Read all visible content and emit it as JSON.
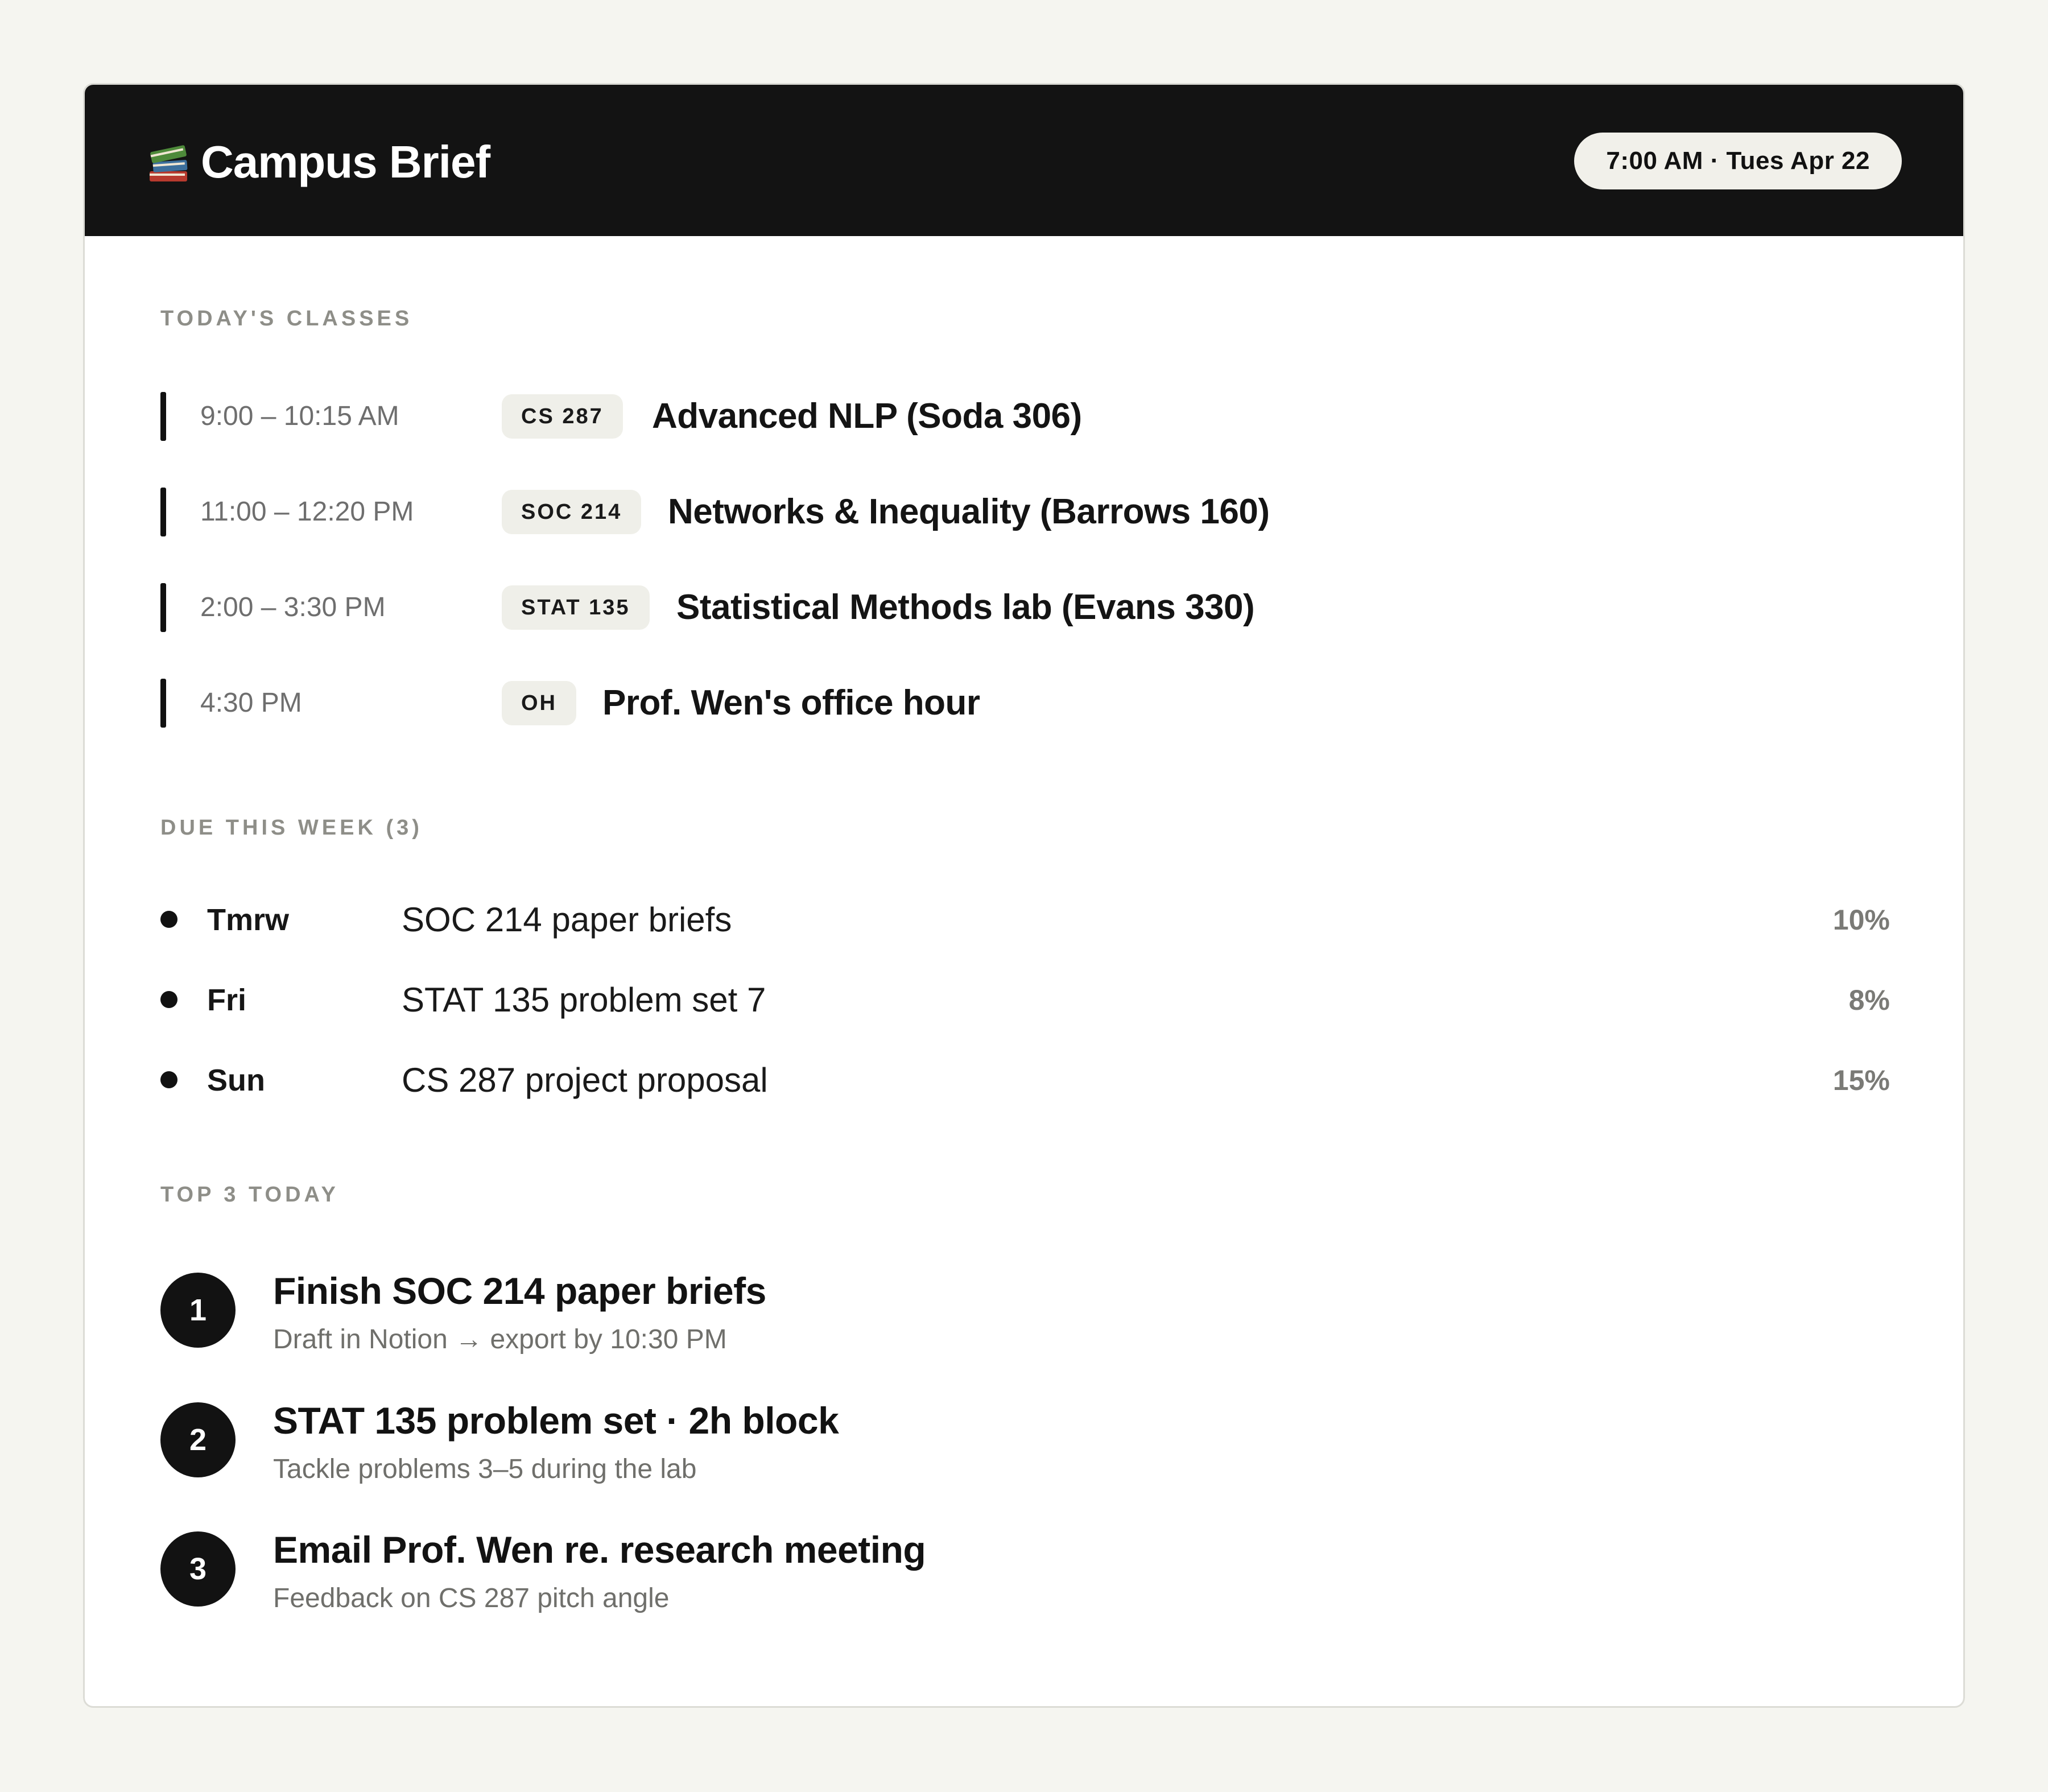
{
  "header": {
    "title": "Campus Brief",
    "icon": "books-icon",
    "time_pill": "7:00 AM · Tues Apr 22"
  },
  "colors": {
    "header_bg": "#131313",
    "page_bg": "#f5f5f0",
    "chip_bg": "#efefe9",
    "muted_text": "#8e8e88"
  },
  "classes": {
    "label": "TODAY'S CLASSES",
    "items": [
      {
        "time": "9:00 – 10:15 AM",
        "code": "CS 287",
        "title": "Advanced NLP (Soda 306)"
      },
      {
        "time": "11:00 – 12:20 PM",
        "code": "SOC 214",
        "title": "Networks & Inequality (Barrows 160)"
      },
      {
        "time": "2:00 – 3:30 PM",
        "code": "STAT 135",
        "title": "Statistical Methods lab (Evans 330)"
      },
      {
        "time": "4:30 PM",
        "code": "OH",
        "title": "Prof. Wen's office hour"
      }
    ]
  },
  "due": {
    "label": "DUE THIS WEEK (3)",
    "items": [
      {
        "day": "Tmrw",
        "task": "SOC 214 paper briefs",
        "weight": "10%"
      },
      {
        "day": "Fri",
        "task": "STAT 135 problem set 7",
        "weight": "8%"
      },
      {
        "day": "Sun",
        "task": "CS 287 project proposal",
        "weight": "15%"
      }
    ]
  },
  "top3": {
    "label": "TOP 3 TODAY",
    "items": [
      {
        "num": "1",
        "title": "Finish SOC 214 paper briefs",
        "sub": "Draft in Notion → export by 10:30 PM"
      },
      {
        "num": "2",
        "title": "STAT 135 problem set · 2h block",
        "sub": "Tackle problems 3–5 during the lab"
      },
      {
        "num": "3",
        "title": "Email Prof. Wen re. research meeting",
        "sub": "Feedback on CS 287 pitch angle"
      }
    ]
  }
}
